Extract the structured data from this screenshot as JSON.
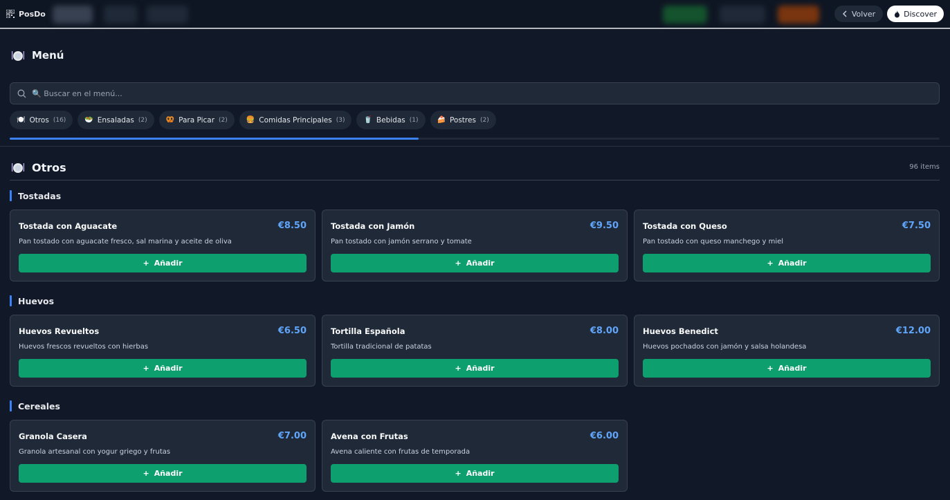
{
  "app": {
    "brand": "PosDo"
  },
  "nav": {
    "back_label": "Volver",
    "discover_label": "Discover"
  },
  "menu": {
    "title": "Menú"
  },
  "search": {
    "placeholder": "🔍 Buscar en el menú..."
  },
  "categories": [
    {
      "icon": "🍽️",
      "label": "Otros",
      "count": "(16)"
    },
    {
      "icon": "🥗",
      "label": "Ensaladas",
      "count": "(2)"
    },
    {
      "icon": "🥨",
      "label": "Para Picar",
      "count": "(2)"
    },
    {
      "icon": "🍔",
      "label": "Comidas Principales",
      "count": "(3)"
    },
    {
      "icon": "🥤",
      "label": "Bebidas",
      "count": "(1)"
    },
    {
      "icon": "🍰",
      "label": "Postres",
      "count": "(2)"
    }
  ],
  "scroll_progress": 0.44,
  "section": {
    "title": "Otros",
    "count": "96 items"
  },
  "add_label": "Añadir",
  "groups": [
    {
      "name": "Tostadas",
      "items": [
        {
          "name": "Tostada con Aguacate",
          "price": "€8.50",
          "desc": "Pan tostado con aguacate fresco, sal marina y aceite de oliva"
        },
        {
          "name": "Tostada con Jamón",
          "price": "€9.50",
          "desc": "Pan tostado con jamón serrano y tomate"
        },
        {
          "name": "Tostada con Queso",
          "price": "€7.50",
          "desc": "Pan tostado con queso manchego y miel"
        }
      ]
    },
    {
      "name": "Huevos",
      "items": [
        {
          "name": "Huevos Revueltos",
          "price": "€6.50",
          "desc": "Huevos frescos revueltos con hierbas"
        },
        {
          "name": "Tortilla Española",
          "price": "€8.00",
          "desc": "Tortilla tradicional de patatas"
        },
        {
          "name": "Huevos Benedict",
          "price": "€12.00",
          "desc": "Huevos pochados con jamón y salsa holandesa"
        }
      ]
    },
    {
      "name": "Cereales",
      "items": [
        {
          "name": "Granola Casera",
          "price": "€7.00",
          "desc": "Granola artesanal con yogur griego y frutas"
        },
        {
          "name": "Avena con Frutas",
          "price": "€6.00",
          "desc": "Avena caliente con frutas de temporada"
        }
      ]
    }
  ]
}
